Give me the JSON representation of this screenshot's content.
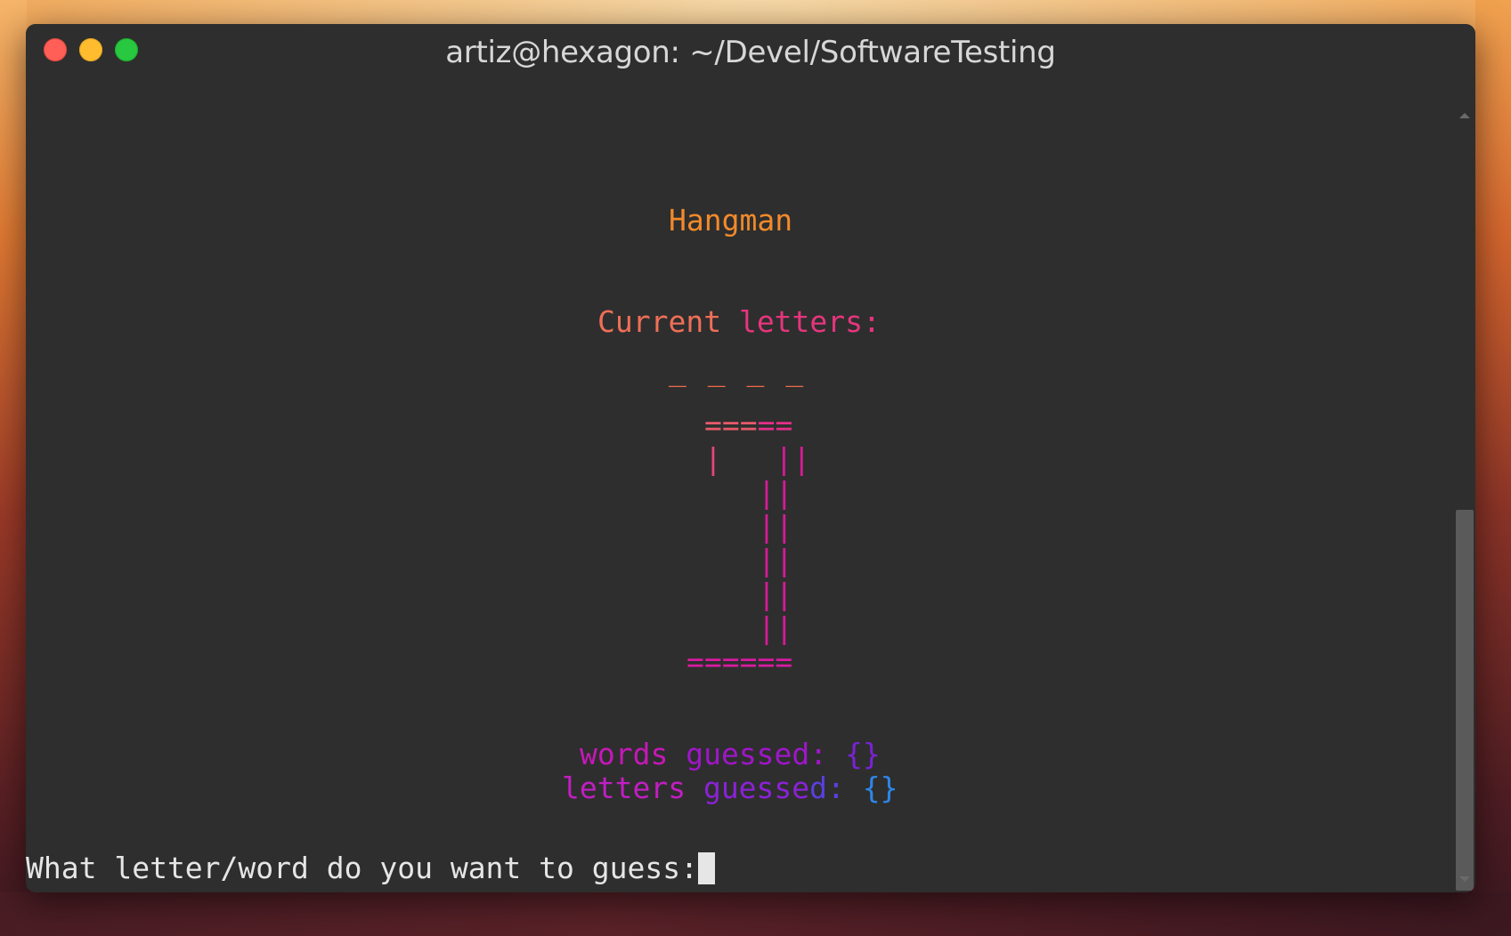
{
  "window": {
    "title": "artiz@hexagon: ~/Devel/SoftwareTesting"
  },
  "terminal": {
    "game_title": "Hangman",
    "current_letters_label_a": "Current",
    "current_letters_label_b": " letters:",
    "blanks": "_ _ _ _",
    "gallows": {
      "row1_a": "===",
      "row1_b": "==",
      "row2_rope": "|",
      "row2_pole": "   ||",
      "pole": "||",
      "base": "======"
    },
    "words_guessed_a": "words",
    "words_guessed_b": " guessed:",
    "words_guessed_c": " {}",
    "letters_guessed_a": "letters",
    "letters_guessed_b": " guesse",
    "letters_guessed_c": "d:",
    "letters_guessed_d": " {}",
    "prompt": "What letter/word do you want to guess:"
  },
  "colors": {
    "window_bg": "#2e2e2e",
    "title_text": "#d7d7d7",
    "game_title": "#f28a2b",
    "prompt_text": "#e6e6e6"
  }
}
